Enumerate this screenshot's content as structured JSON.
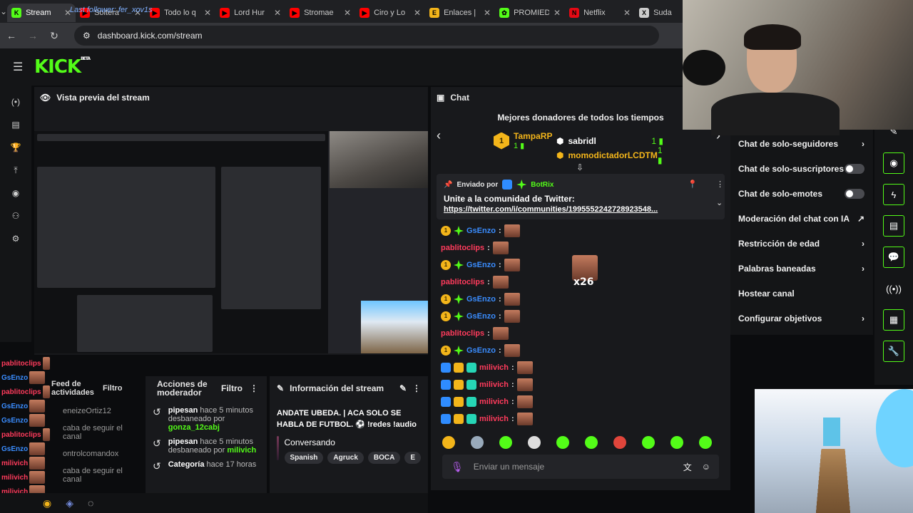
{
  "browser": {
    "tabs": [
      {
        "title": "Stream",
        "color": "#53fc18",
        "letter": "K",
        "active": true
      },
      {
        "title": "Soltera",
        "color": "#ff0000",
        "letter": "▶"
      },
      {
        "title": "Todo lo q",
        "color": "#ff0000",
        "letter": "▶"
      },
      {
        "title": "Lord Hur",
        "color": "#ff0000",
        "letter": "▶"
      },
      {
        "title": "Stromae",
        "color": "#ff0000",
        "letter": "▶"
      },
      {
        "title": "Ciro y Lo",
        "color": "#ff0000",
        "letter": "▶"
      },
      {
        "title": "Enlaces |",
        "color": "#f3b51a",
        "letter": "E"
      },
      {
        "title": "PROMIED",
        "color": "#53fc18",
        "letter": "✿"
      },
      {
        "title": "Netflix",
        "color": "#e50914",
        "letter": "N"
      },
      {
        "title": "Suda",
        "color": "#cccccc",
        "letter": "X"
      }
    ],
    "overlay_text": "Last follower: fer_xov1s",
    "url": "dashboard.kick.com/stream"
  },
  "kick": {
    "logo": "KICK",
    "logo_sup": "BETA"
  },
  "preview": {
    "title": "Vista previa del stream"
  },
  "chat_log_left": [
    {
      "name": "pablitoclips",
      "color": "#ff3b5c"
    },
    {
      "name": "GsEnzo",
      "color": "#3a8dff"
    },
    {
      "name": "pablitoclips",
      "color": "#ff3b5c"
    },
    {
      "name": "GsEnzo",
      "color": "#3a8dff"
    },
    {
      "name": "GsEnzo",
      "color": "#3a8dff"
    },
    {
      "name": "pablitoclips",
      "color": "#ff3b5c"
    },
    {
      "name": "GsEnzo",
      "color": "#3a8dff"
    },
    {
      "name": "milivich",
      "color": "#ff3b5c"
    },
    {
      "name": "milivich",
      "color": "#ff3b5c"
    },
    {
      "name": "milivich",
      "color": "#ff3b5c"
    },
    {
      "name": "milivich",
      "color": "#ff3b5c"
    }
  ],
  "feed": {
    "title": "Feed de actividades",
    "filter": "Filtro",
    "items": [
      "eneizeOrtiz12",
      "caba de seguir el canal",
      "ontrolcomandox",
      "caba de seguir el canal"
    ]
  },
  "moderator": {
    "title": "Acciones de moderador",
    "filter": "Filtro",
    "items": [
      {
        "user": "pipesan",
        "time": "hace 5 minutos",
        "action": "desbaneado por",
        "by": "gonza_12cabj"
      },
      {
        "user": "pipesan",
        "time": "hace 5 minutos",
        "action": "desbaneado por",
        "by": "milivich"
      },
      {
        "user": "Categoría",
        "time": "hace 17 horas",
        "action": "",
        "by": ""
      }
    ]
  },
  "stream_info": {
    "title": "Información del stream",
    "stream_title": "ANDATE UBEDA. | ACA SOLO SE HABLA DE FUTBOL. ⚽ !redes !audio",
    "category": "Conversando",
    "tags": [
      "Spanish",
      "Agruck",
      "BOCA",
      "E"
    ]
  },
  "chat": {
    "title": "Chat",
    "donors_title": "Mejores donadores de todos los tiempos",
    "top_donor": {
      "rank": "1",
      "name": "TampaRP",
      "value": "1"
    },
    "donors": [
      {
        "name": "sabridl",
        "value": "1",
        "color": "#ffffff"
      },
      {
        "name": "momodictadorLCDTM",
        "value": "1",
        "color": "#f3b51a"
      }
    ],
    "pinned": {
      "sent_by_label": "Enviado por",
      "sender": "BotRix",
      "message": "Unite a la comunidad de Twitter:",
      "link": "https://twitter.com/i/communities/1995552242728923548..."
    },
    "messages": [
      {
        "user": "GsEnzo",
        "color": "#3a8dff",
        "badges": [
          "gold",
          "green"
        ]
      },
      {
        "user": "pablitoclips",
        "color": "#ff3b5c",
        "badges": []
      },
      {
        "user": "GsEnzo",
        "color": "#3a8dff",
        "badges": [
          "gold",
          "green"
        ]
      },
      {
        "user": "pablitoclips",
        "color": "#ff3b5c",
        "badges": []
      },
      {
        "user": "GsEnzo",
        "color": "#3a8dff",
        "badges": [
          "gold",
          "green"
        ]
      },
      {
        "user": "GsEnzo",
        "color": "#3a8dff",
        "badges": [
          "gold",
          "green"
        ]
      },
      {
        "user": "pablitoclips",
        "color": "#ff3b5c",
        "badges": []
      },
      {
        "user": "GsEnzo",
        "color": "#3a8dff",
        "badges": [
          "gold",
          "green"
        ]
      },
      {
        "user": "milivich",
        "color": "#ff3b5c",
        "badges": [
          "blue",
          "crown",
          "cyan"
        ]
      },
      {
        "user": "milivich",
        "color": "#ff3b5c",
        "badges": [
          "blue",
          "crown",
          "cyan"
        ]
      },
      {
        "user": "milivich",
        "color": "#ff3b5c",
        "badges": [
          "blue",
          "crown",
          "cyan"
        ]
      },
      {
        "user": "milivich",
        "color": "#ff3b5c",
        "badges": [
          "blue",
          "crown",
          "cyan"
        ]
      }
    ],
    "combo": "x26",
    "input_placeholder": "Enviar un mensaje"
  },
  "settings": {
    "items": [
      {
        "label": "Chat de solo-seguidores",
        "control": "chevron"
      },
      {
        "label": "Chat de solo-suscriptores",
        "control": "toggle"
      },
      {
        "label": "Chat de solo-emotes",
        "control": "toggle"
      },
      {
        "label": "Moderación del chat con IA",
        "control": "external"
      },
      {
        "label": "Restricción de edad",
        "control": "chevron"
      },
      {
        "label": "Palabras baneadas",
        "control": "chevron"
      },
      {
        "label": "Hostear canal",
        "control": "none"
      },
      {
        "label": "Configurar objetivos",
        "control": "chevron"
      }
    ]
  },
  "colors": {
    "accent": "#53fc18",
    "background": "#0b0c0e",
    "panel": "#18191c"
  }
}
